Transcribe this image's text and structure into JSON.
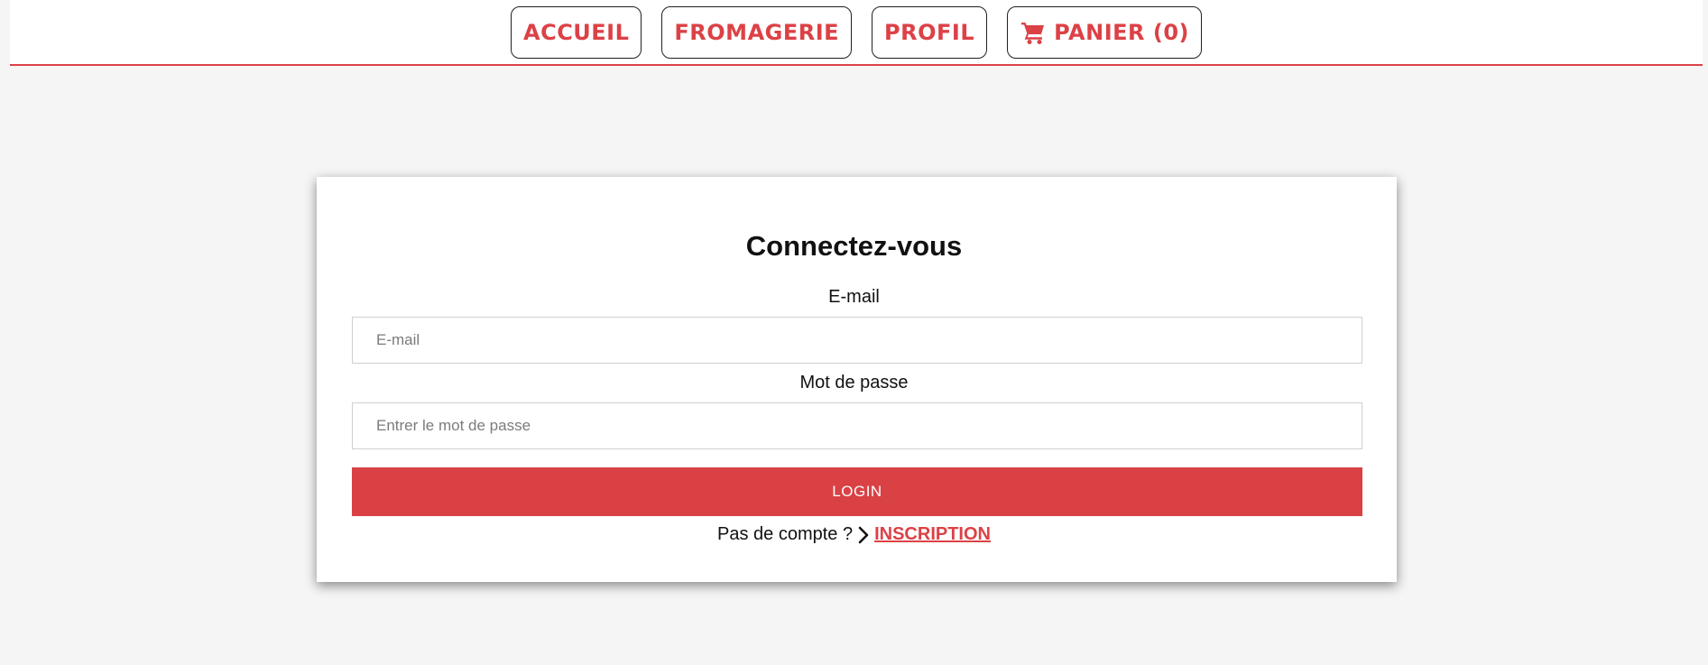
{
  "header": {
    "nav": {
      "home_label": "ACCUEIL",
      "shop_label": "FROMAGERIE",
      "profile_label": "PROFIL",
      "cart_label": "PANIER (0)",
      "cart_icon": "shopping-cart-icon"
    }
  },
  "login": {
    "title": "Connectez-vous",
    "email_label": "E-mail",
    "email_placeholder": "E-mail",
    "email_value": "",
    "password_label": "Mot de passe",
    "password_placeholder": "Entrer le mot de passe",
    "password_value": "",
    "submit_label": "LOGIN",
    "no_account_text": "Pas de compte ?",
    "chevron_icon": "chevron-right-icon",
    "signup_label": "INSCRIPTION"
  },
  "colors": {
    "accent": "#dc4146",
    "page_background": "#f4f5f4",
    "card_background": "#ffffff",
    "text": "#111111"
  }
}
